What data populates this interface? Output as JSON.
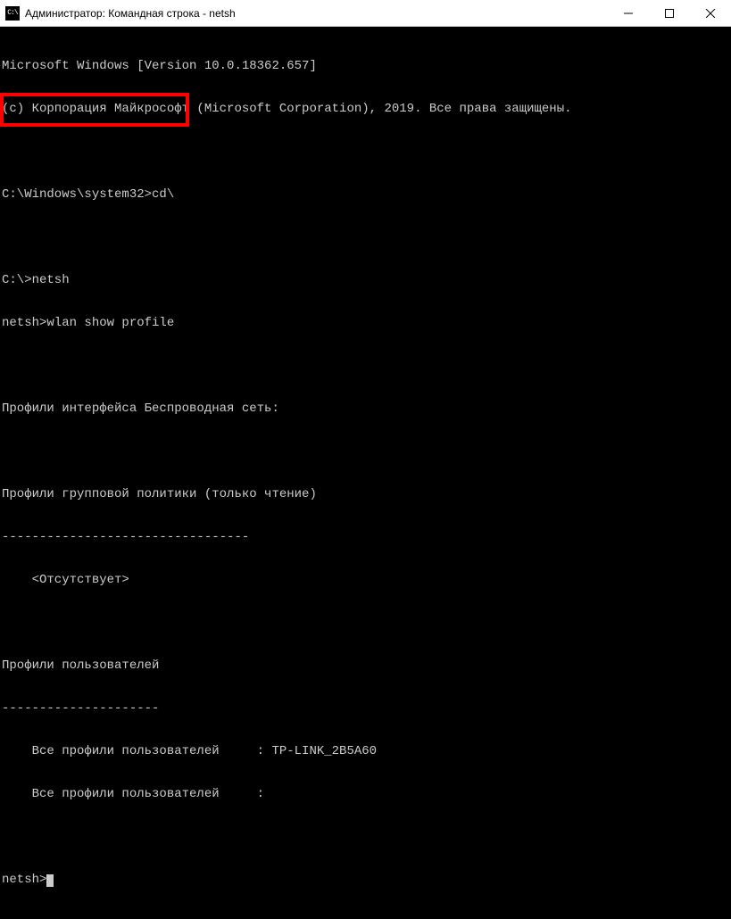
{
  "window": {
    "title": "Администратор: Командная строка - netsh"
  },
  "terminal": {
    "lines": [
      "Microsoft Windows [Version 10.0.18362.657]",
      "(с) Корпорация Майкрософт (Microsoft Corporation), 2019. Все права защищены.",
      "",
      "C:\\Windows\\system32>cd\\",
      "",
      "C:\\>netsh",
      "netsh>wlan show profile",
      "",
      "Профили интерфейса Беспроводная сеть:",
      "",
      "Профили групповой политики (только чтение)",
      "---------------------------------",
      "    <Отсутствует>",
      "",
      "Профили пользователей",
      "---------------------",
      "    Все профили пользователей     : TP-LINK_2B5A60",
      "    Все профили пользователей     :",
      "",
      "netsh>"
    ]
  }
}
